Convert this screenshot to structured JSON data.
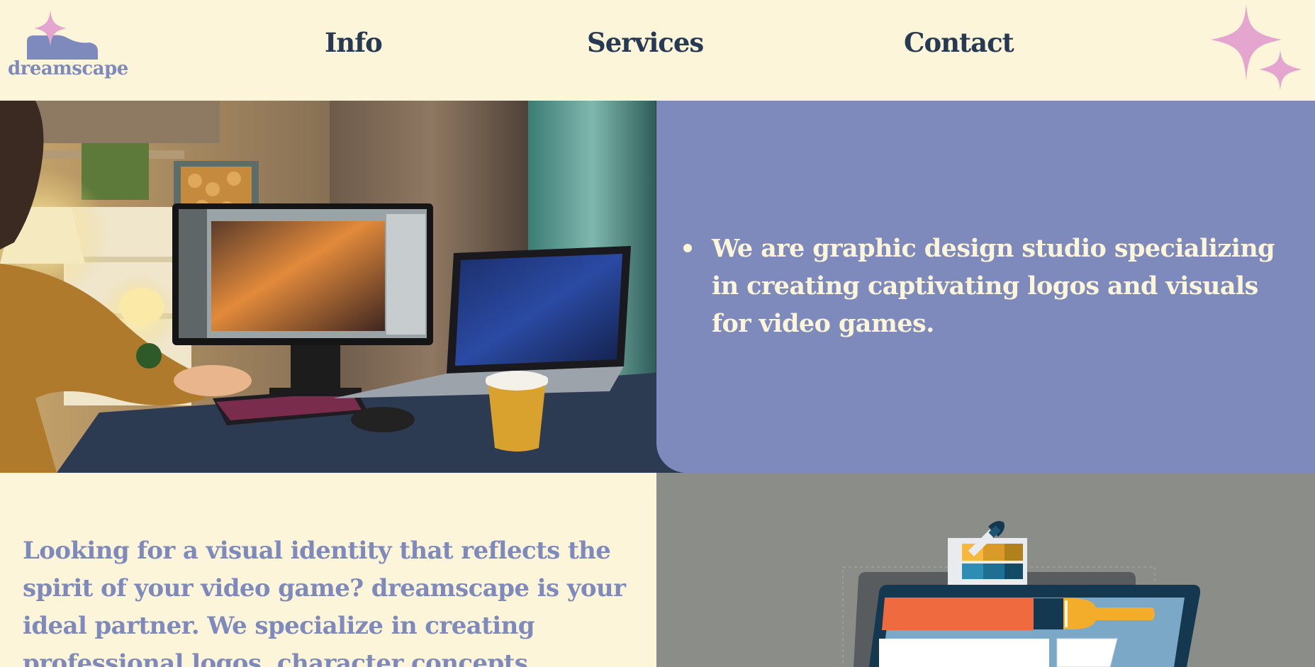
{
  "brand": {
    "name": "dreamscape"
  },
  "nav": {
    "info": "Info",
    "services": "Services",
    "contact": "Contact"
  },
  "intro": {
    "items": [
      "We are graphic design studio specializing in creating captivating logos and visuals for video games."
    ]
  },
  "about": {
    "text": "Looking for a visual identity that reflects the spirit of your video game? dreamscape is your ideal partner. We specialize in creating professional logos, character concepts,"
  },
  "colors": {
    "background": "#fdf5d9",
    "accent_blue": "#7d8abb",
    "navy": "#263a54",
    "pink": "#e4a6cf",
    "gray": "#8a8d88"
  },
  "icons": [
    "sparkle-icon",
    "logo-mark-icon"
  ]
}
